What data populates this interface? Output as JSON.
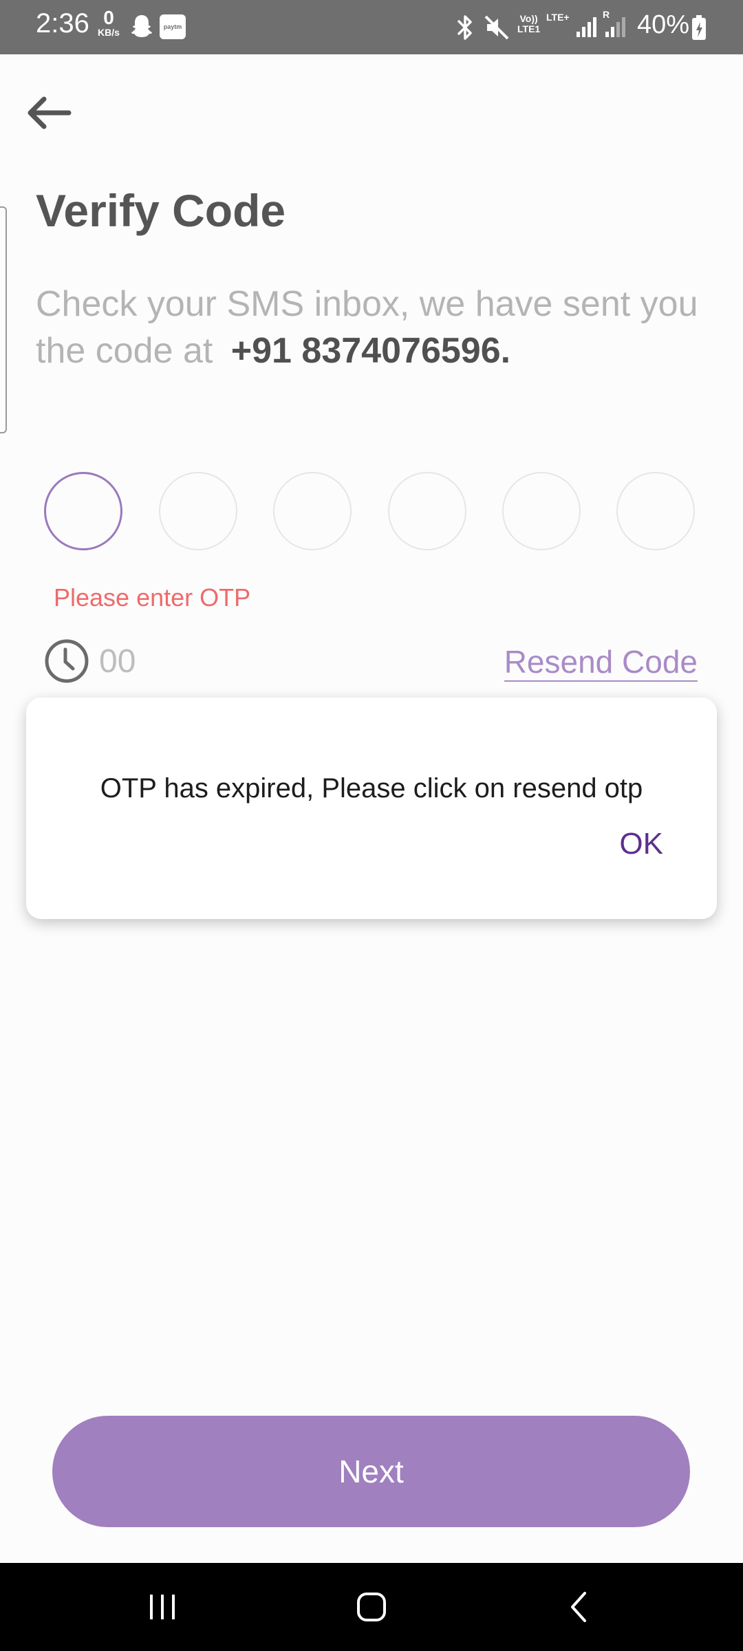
{
  "status_bar": {
    "time": "2:36",
    "data_speed_value": "0",
    "data_speed_unit": "KB/s",
    "paytm_label": "paytm",
    "network_volte": "Vo))",
    "network_lte1": "LTE1",
    "network_lteplus": "LTE+",
    "network_roaming": "R",
    "battery": "40%"
  },
  "screen": {
    "title": "Verify Code",
    "subtitle_text": "Check your SMS inbox, we have sent you the code at",
    "phone": "+91 8374076596.",
    "otp_error": "Please enter OTP",
    "timer": "00",
    "resend_label": "Resend Code",
    "next_label": "Next"
  },
  "dialog": {
    "message": "OTP has expired, Please click on resend otp",
    "ok_label": "OK"
  },
  "colors": {
    "accent": "#a080be",
    "accent_dark": "#5d2f8e",
    "error": "#ef6a6a"
  }
}
